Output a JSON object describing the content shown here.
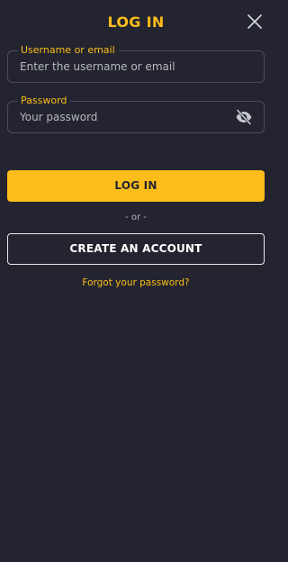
{
  "header": {
    "title": "LOG IN",
    "close_icon": "close-icon"
  },
  "form": {
    "username": {
      "label": "Username or email",
      "placeholder": "Enter the username or email",
      "value": ""
    },
    "password": {
      "label": "Password",
      "placeholder": "Your password",
      "value": "",
      "toggle_icon": "eye-off-icon"
    }
  },
  "actions": {
    "login_label": "LOG IN",
    "separator": "- or -",
    "create_account_label": "CREATE AN ACCOUNT",
    "forgot_password": "Forgot your password?"
  },
  "colors": {
    "background": "#23242f",
    "accent": "#fbbd1a",
    "border": "#4a4b57",
    "text": "#e8e8ec"
  }
}
